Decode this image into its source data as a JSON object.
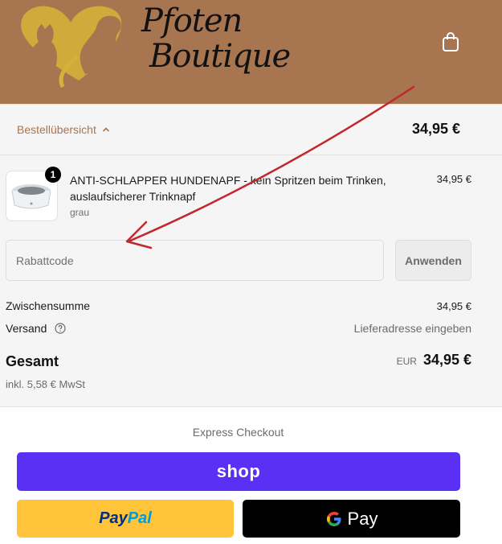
{
  "header": {
    "brand_line1": "Pfoten",
    "brand_line2": "Boutique",
    "background_color": "#a87551",
    "cart_icon": "shopping-bag-icon"
  },
  "summary": {
    "toggle_label": "Bestellübersicht",
    "toggle_icon": "chevron-up-icon",
    "total": "34,95 €"
  },
  "order": {
    "items": [
      {
        "quantity": "1",
        "name": "ANTI-SCHLAPPER HUNDENAPF - kein Spritzen beim Trinken, auslaufsicherer Trinknapf",
        "variant": "grau",
        "price": "34,95 €"
      }
    ]
  },
  "discount": {
    "placeholder": "Rabattcode",
    "apply_label": "Anwenden"
  },
  "totals": {
    "subtotal_label": "Zwischensumme",
    "subtotal_value": "34,95 €",
    "shipping_label": "Versand",
    "shipping_value": "Lieferadresse eingeben",
    "total_label": "Gesamt",
    "total_currency": "EUR",
    "total_value": "34,95 €",
    "tax_note": "inkl. 5,58 € MwSt"
  },
  "express": {
    "title": "Express Checkout",
    "shop_label": "shop",
    "paypal_label_part1": "Pay",
    "paypal_label_part2": "Pal",
    "gpay_label": "Pay",
    "colors": {
      "shop": "#5a31f4",
      "paypal": "#ffc439",
      "gpay": "#000000"
    }
  },
  "annotation": {
    "arrow_color": "#c0282d"
  }
}
